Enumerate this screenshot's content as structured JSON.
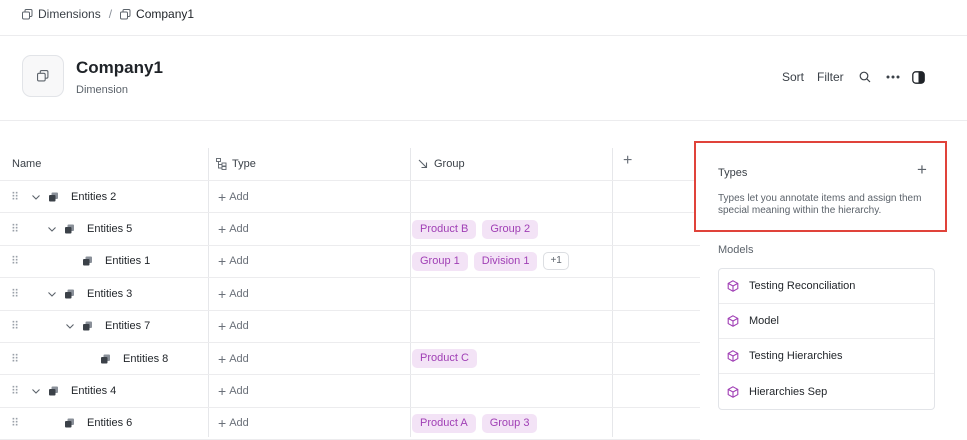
{
  "breadcrumb": {
    "parent": "Dimensions",
    "current": "Company1"
  },
  "header": {
    "title": "Company1",
    "subtitle": "Dimension"
  },
  "toolbar": {
    "sort": "Sort",
    "filter": "Filter"
  },
  "columns": {
    "name": "Name",
    "type": "Type",
    "group": "Group"
  },
  "add_label": "Add",
  "rows": [
    {
      "label": "Entities 2",
      "level": 0,
      "expanded": true,
      "groups": []
    },
    {
      "label": "Entities 5",
      "level": 1,
      "expanded": true,
      "groups": [
        "Product B",
        "Group 2"
      ]
    },
    {
      "label": "Entities 1",
      "level": 2,
      "expanded": false,
      "groups": [
        "Group 1",
        "Division 1"
      ],
      "more": "+1"
    },
    {
      "label": "Entities 3",
      "level": 1,
      "expanded": true,
      "groups": []
    },
    {
      "label": "Entities 7",
      "level": 2,
      "expanded": true,
      "groups": []
    },
    {
      "label": "Entities 8",
      "level": 3,
      "expanded": false,
      "groups": [
        "Product C"
      ]
    },
    {
      "label": "Entities 4",
      "level": 0,
      "expanded": true,
      "groups": []
    },
    {
      "label": "Entities 6",
      "level": 1,
      "expanded": false,
      "groups": [
        "Product A",
        "Group 3"
      ]
    }
  ],
  "types_panel": {
    "title": "Types",
    "description": "Types let you annotate items and assign them special meaning within the hierarchy."
  },
  "models": {
    "title": "Models",
    "items": [
      "Testing Reconciliation",
      "Model",
      "Testing Hierarchies",
      "Hierarchies Sep"
    ]
  },
  "colors": {
    "tag_bg": "#f3e3f6",
    "tag_text": "#a03fb5",
    "highlight_border": "#e0433a"
  }
}
